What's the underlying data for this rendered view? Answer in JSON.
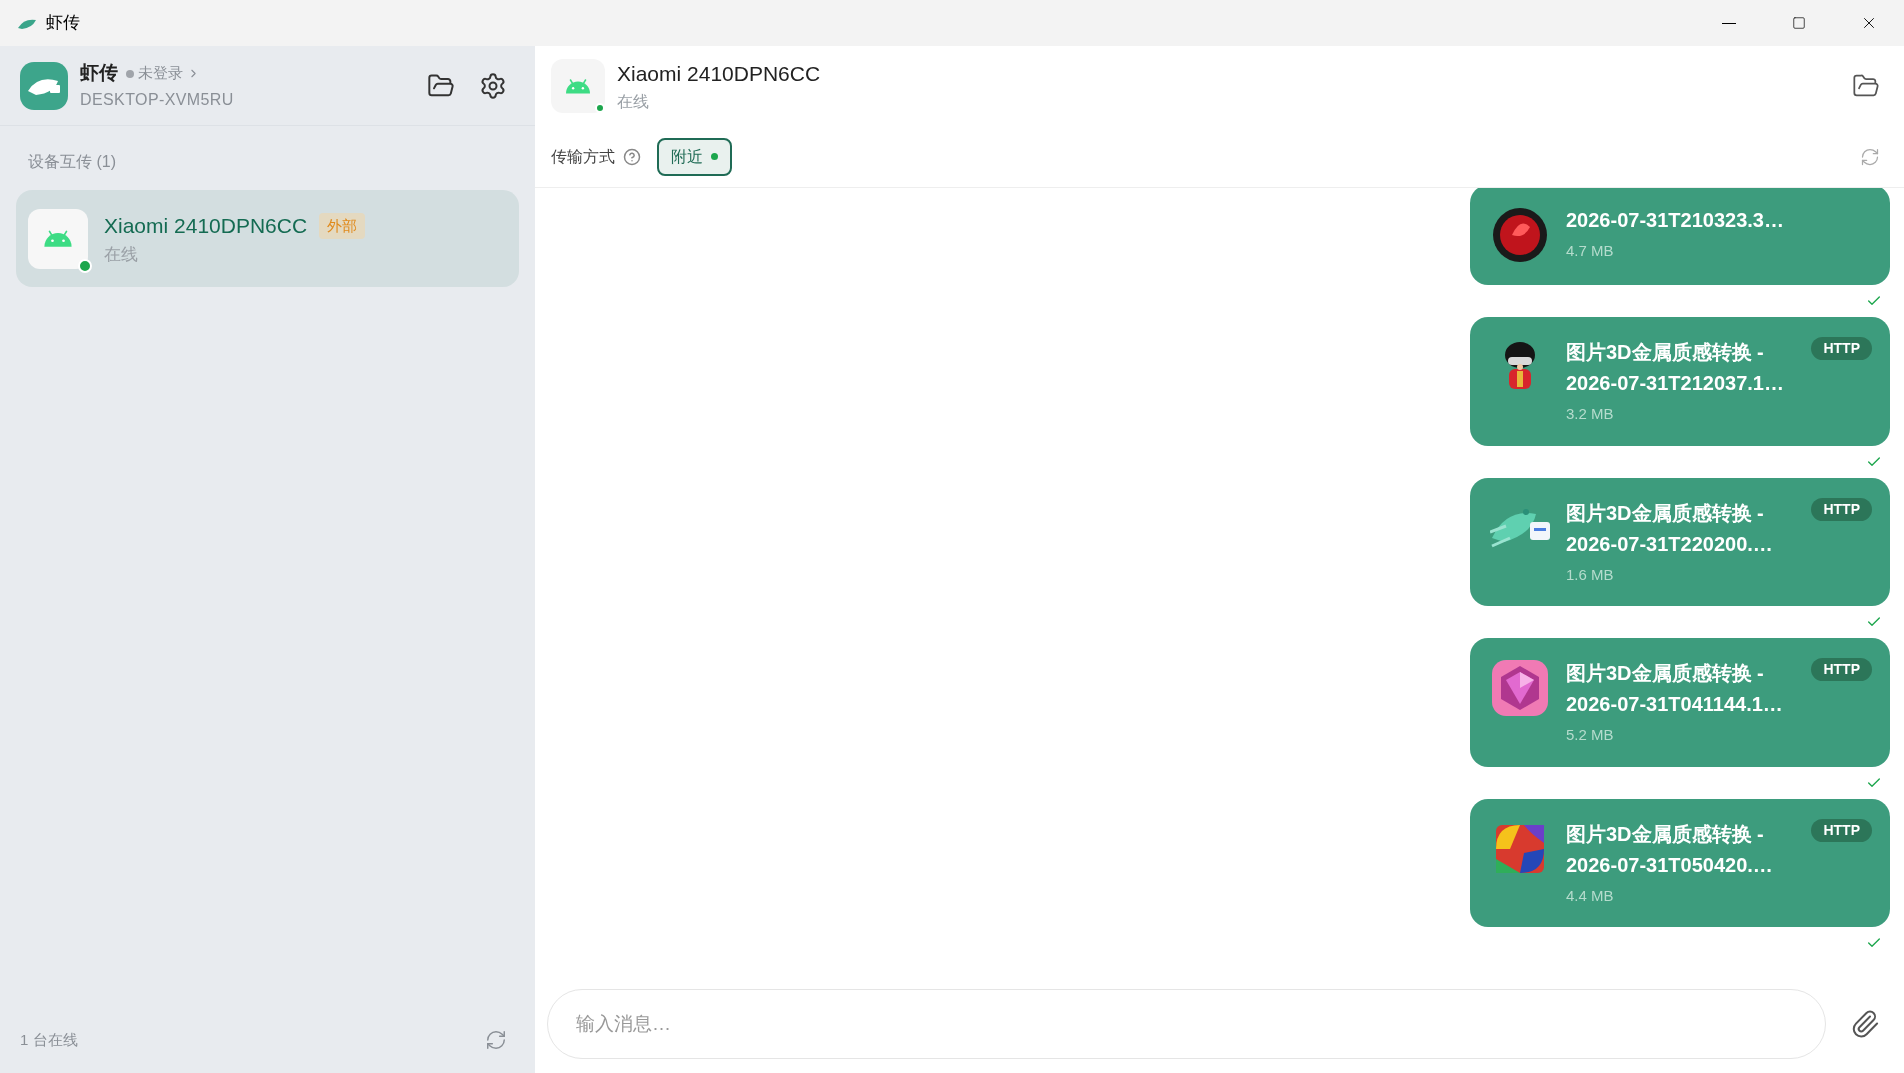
{
  "window": {
    "title": "虾传"
  },
  "sidebar": {
    "app_name": "虾传",
    "login_status": "未登录",
    "device_name": "DESKTOP-XVM5RU",
    "section_title": "设备互传 (1)",
    "devices": [
      {
        "name": "Xiaomi 2410DPN6CC",
        "badge": "外部",
        "status": "在线",
        "online": true,
        "selected": true
      }
    ],
    "footer": "1 台在线"
  },
  "chat": {
    "device_name": "Xiaomi 2410DPN6CC",
    "status": "在线",
    "online": true,
    "transport_label": "传输方式",
    "transport_mode": "附近",
    "transport_active": true,
    "messages": [
      {
        "lines": [
          "2026-07-31T210323.3…"
        ],
        "size": "4.7 MB",
        "delivered": true
      },
      {
        "lines": [
          "图片3D金属质感转换 -",
          "2026-07-31T212037.1…"
        ],
        "size": "3.2 MB",
        "badge": "HTTP",
        "delivered": true
      },
      {
        "lines": [
          "图片3D金属质感转换 -",
          "2026-07-31T220200.…"
        ],
        "size": "1.6 MB",
        "badge": "HTTP",
        "delivered": true
      },
      {
        "lines": [
          "图片3D金属质感转换 -",
          "2026-07-31T041144.1…"
        ],
        "size": "5.2 MB",
        "badge": "HTTP",
        "delivered": true
      },
      {
        "lines": [
          "图片3D金属质感转换 -",
          "2026-07-31T050420.…"
        ],
        "size": "4.4 MB",
        "badge": "HTTP",
        "delivered": true
      }
    ],
    "input": {
      "placeholder": "输入消息…"
    }
  }
}
